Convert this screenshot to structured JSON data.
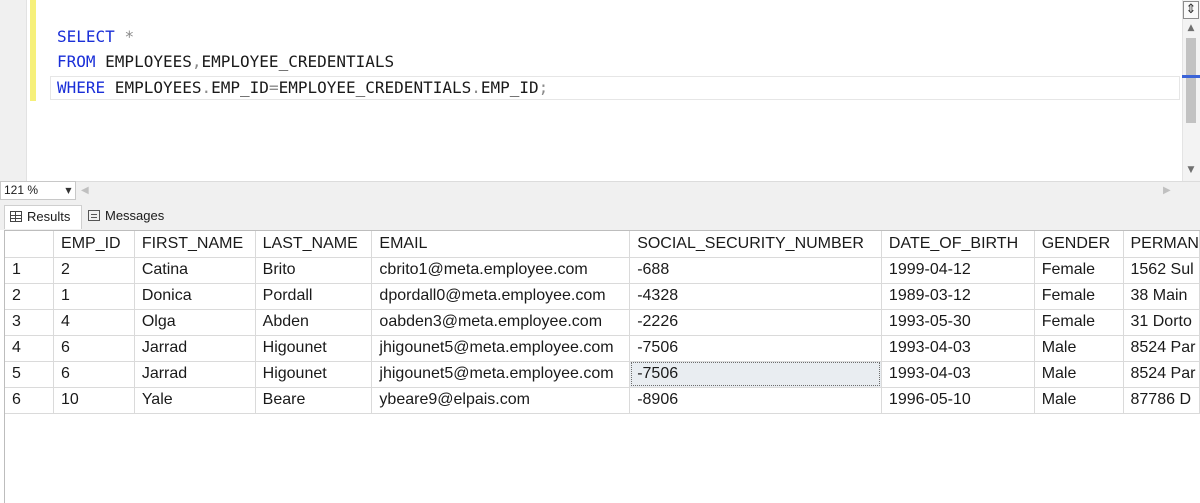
{
  "editor": {
    "lines": [
      [
        {
          "t": "SELECT",
          "c": "kw"
        },
        {
          "t": " ",
          "c": ""
        },
        {
          "t": "*",
          "c": "op"
        }
      ],
      [
        {
          "t": "FROM",
          "c": "kw"
        },
        {
          "t": " EMPLOYEES",
          "c": ""
        },
        {
          "t": ",",
          "c": "op"
        },
        {
          "t": "EMPLOYEE_CREDENTIALS",
          "c": ""
        }
      ],
      [
        {
          "t": "WHERE",
          "c": "kw"
        },
        {
          "t": " EMPLOYEES",
          "c": ""
        },
        {
          "t": ".",
          "c": "op"
        },
        {
          "t": "EMP_ID",
          "c": ""
        },
        {
          "t": "=",
          "c": "op"
        },
        {
          "t": "EMPLOYEE_CREDENTIALS",
          "c": ""
        },
        {
          "t": ".",
          "c": "op"
        },
        {
          "t": "EMP_ID",
          "c": ""
        },
        {
          "t": ";",
          "c": "op"
        }
      ]
    ]
  },
  "zoom": {
    "value": "121 %"
  },
  "tabs": {
    "results_label": "Results",
    "messages_label": "Messages"
  },
  "results": {
    "columns": [
      "",
      "EMP_ID",
      "FIRST_NAME",
      "LAST_NAME",
      "EMAIL",
      "SOCIAL_SECURITY_NUMBER",
      "DATE_OF_BIRTH",
      "GENDER",
      "PERMAN"
    ],
    "rows": [
      [
        "1",
        "2",
        "Catina",
        "Brito",
        "cbrito1@meta.employee.com",
        "-688",
        "1999-04-12",
        "Female",
        "1562 Sul"
      ],
      [
        "2",
        "1",
        "Donica",
        "Pordall",
        "dpordall0@meta.employee.com",
        "-4328",
        "1989-03-12",
        "Female",
        "38 Main"
      ],
      [
        "3",
        "4",
        "Olga",
        "Abden",
        "oabden3@meta.employee.com",
        "-2226",
        "1993-05-30",
        "Female",
        "31 Dorto"
      ],
      [
        "4",
        "6",
        "Jarrad",
        "Higounet",
        "jhigounet5@meta.employee.com",
        "-7506",
        "1993-04-03",
        "Male",
        "8524 Par"
      ],
      [
        "5",
        "6",
        "Jarrad",
        "Higounet",
        "jhigounet5@meta.employee.com",
        "-7506",
        "1993-04-03",
        "Male",
        "8524 Par"
      ],
      [
        "6",
        "10",
        "Yale",
        "Beare",
        "ybeare9@elpais.com",
        "-8906",
        "1996-05-10",
        "Male",
        "87786 D"
      ]
    ],
    "selected_cell": {
      "row": 4,
      "col": 5
    }
  },
  "colors": {
    "keyword": "#1a2fd8",
    "change_bar": "#f6f07a",
    "selected_cell": "#e9edf1"
  }
}
